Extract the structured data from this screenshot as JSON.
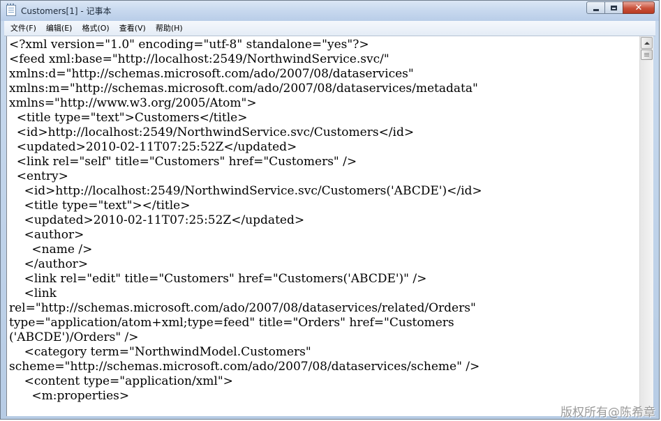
{
  "window": {
    "title": "Customers[1] - 记事本",
    "icon": "notepad-icon",
    "buttons": {
      "minimize": "minimize-icon",
      "maximize": "maximize-icon",
      "close": "close-icon"
    }
  },
  "menu": [
    {
      "label": "文件(F)"
    },
    {
      "label": "编辑(E)"
    },
    {
      "label": "格式(O)"
    },
    {
      "label": "查看(V)"
    },
    {
      "label": "帮助(H)"
    }
  ],
  "document": {
    "lines": [
      "<?xml version=\"1.0\" encoding=\"utf-8\" standalone=\"yes\"?>",
      "<feed xml:base=\"http://localhost:2549/NorthwindService.svc/\"",
      "xmlns:d=\"http://schemas.microsoft.com/ado/2007/08/dataservices\"",
      "xmlns:m=\"http://schemas.microsoft.com/ado/2007/08/dataservices/metadata\"",
      "xmlns=\"http://www.w3.org/2005/Atom\">",
      "  <title type=\"text\">Customers</title>",
      "  <id>http://localhost:2549/NorthwindService.svc/Customers</id>",
      "  <updated>2010-02-11T07:25:52Z</updated>",
      "  <link rel=\"self\" title=\"Customers\" href=\"Customers\" />",
      "  <entry>",
      "    <id>http://localhost:2549/NorthwindService.svc/Customers('ABCDE')</id>",
      "    <title type=\"text\"></title>",
      "    <updated>2010-02-11T07:25:52Z</updated>",
      "    <author>",
      "      <name />",
      "    </author>",
      "    <link rel=\"edit\" title=\"Customers\" href=\"Customers('ABCDE')\" />",
      "    <link",
      "rel=\"http://schemas.microsoft.com/ado/2007/08/dataservices/related/Orders\"",
      "type=\"application/atom+xml;type=feed\" title=\"Orders\" href=\"Customers",
      "('ABCDE')/Orders\" />",
      "    <category term=\"NorthwindModel.Customers\"",
      "scheme=\"http://schemas.microsoft.com/ado/2007/08/dataservices/scheme\" />",
      "    <content type=\"application/xml\">",
      "      <m:properties>"
    ]
  },
  "watermark": "版权所有@陈希章"
}
